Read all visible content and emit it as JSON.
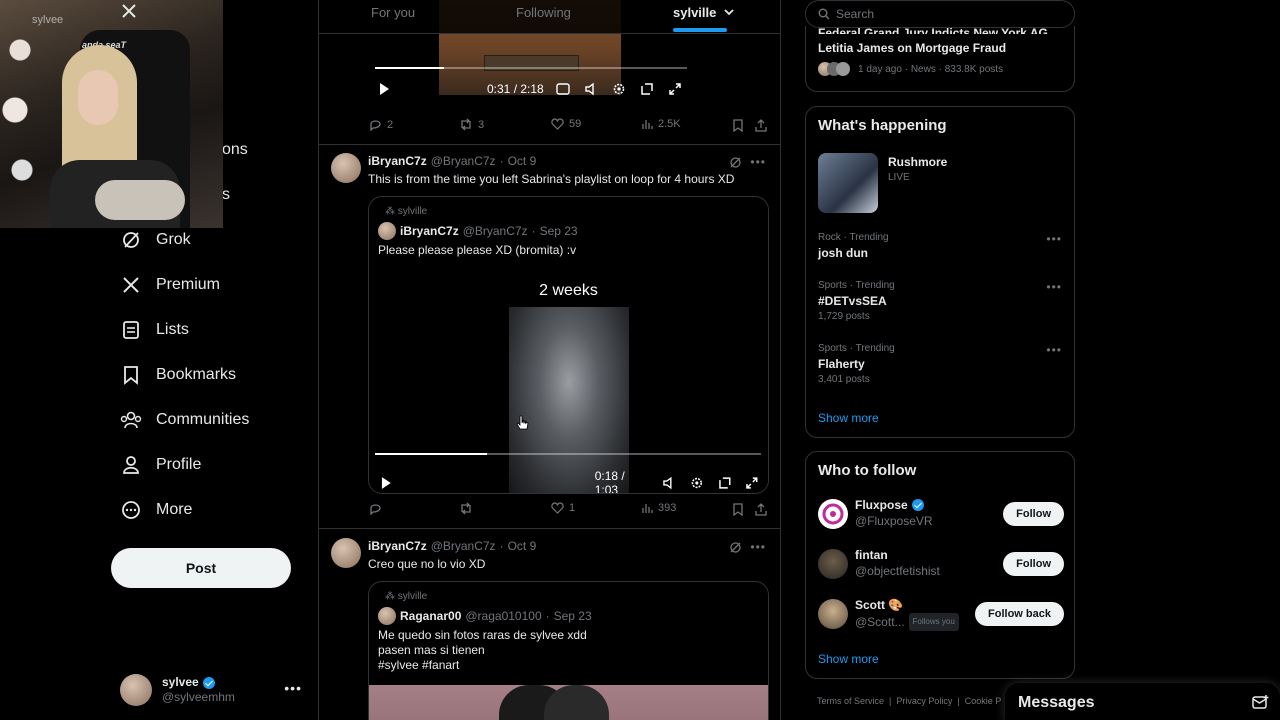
{
  "nav": {
    "partial_labels": [
      "ons",
      "s"
    ],
    "items": [
      {
        "icon": "grok-icon",
        "label": "Grok"
      },
      {
        "icon": "x-logo-icon",
        "label": "Premium"
      },
      {
        "icon": "list-icon",
        "label": "Lists"
      },
      {
        "icon": "bookmark-icon",
        "label": "Bookmarks"
      },
      {
        "icon": "communities-icon",
        "label": "Communities"
      },
      {
        "icon": "profile-icon",
        "label": "Profile"
      },
      {
        "icon": "more-circle-icon",
        "label": "More"
      }
    ],
    "post_label": "Post",
    "account": {
      "display_name": "sylvee",
      "handle": "@sylveemhm"
    }
  },
  "webcam": {
    "chair_text": "anda seaT",
    "name": "sylvee"
  },
  "tabs": [
    {
      "label": "For you"
    },
    {
      "label": "Following"
    },
    {
      "label": "sylville"
    }
  ],
  "tweet0": {
    "video_time": "0:31 / 2:18",
    "video_progress": 0.22,
    "replies": "2",
    "reposts": "3",
    "likes": "59",
    "views": "2.5K"
  },
  "tweet1": {
    "name": "iBryanC7z",
    "handle": "@BryanC7z",
    "date": "Oct 9",
    "text": "This is from the time you left Sabrina's playlist on loop for 4 hours XD",
    "quote": {
      "community": "sylville",
      "name": "iBryanC7z",
      "handle": "@BryanC7z",
      "date": "Sep 23",
      "text": "Please please please XD (bromita) :v",
      "video_caption": "2 weeks",
      "video_time": "0:18 / 1:03",
      "video_progress": 0.29
    },
    "replies": "",
    "reposts": "",
    "likes": "1",
    "views": "393"
  },
  "tweet2": {
    "name": "iBryanC7z",
    "handle": "@BryanC7z",
    "date": "Oct 9",
    "text": "Creo que no lo vio XD",
    "quote": {
      "community": "sylville",
      "name": "Raganar00",
      "handle": "@raga010100",
      "date": "Sep 23",
      "lines": [
        "Me quedo sin fotos raras de sylvee xdd",
        "pasen mas si tienen",
        "#sylvee #fanart"
      ]
    }
  },
  "search": {
    "placeholder": "Search"
  },
  "news": {
    "headline_1": "Federal Grand Jury Indicts New York AG",
    "headline_2": "Letitia James on Mortgage Fraud",
    "meta": "1 day ago · News · 833.8K posts"
  },
  "whats_happening": {
    "title": "What's happening",
    "featured": {
      "name": "Rushmore",
      "status": "LIVE"
    },
    "trends": [
      {
        "meta": "Rock · Trending",
        "name": "josh dun",
        "count": ""
      },
      {
        "meta": "Sports · Trending",
        "name": "#DETvsSEA",
        "count": "1,729 posts"
      },
      {
        "meta": "Sports · Trending",
        "name": "Flaherty",
        "count": "3,401 posts"
      }
    ],
    "show_more": "Show more"
  },
  "who_to_follow": {
    "title": "Who to follow",
    "users": [
      {
        "name": "Fluxpose",
        "handle": "@FluxposeVR",
        "button": "Follow",
        "follows_you": ""
      },
      {
        "name": "fintan",
        "handle": "@objectfetishist",
        "button": "Follow",
        "follows_you": ""
      },
      {
        "name": "Scott 🎨",
        "handle": "@Scott...",
        "button": "Follow back",
        "follows_you": "Follows you"
      }
    ],
    "show_more": "Show more"
  },
  "footer": {
    "links": [
      "Terms of Service",
      "Privacy Policy",
      "Cookie P"
    ]
  },
  "messages": {
    "title": "Messages"
  },
  "colors": {
    "accent": "#1d9bf0",
    "bg": "#000000",
    "border": "#2f3336",
    "muted": "#71767b"
  }
}
